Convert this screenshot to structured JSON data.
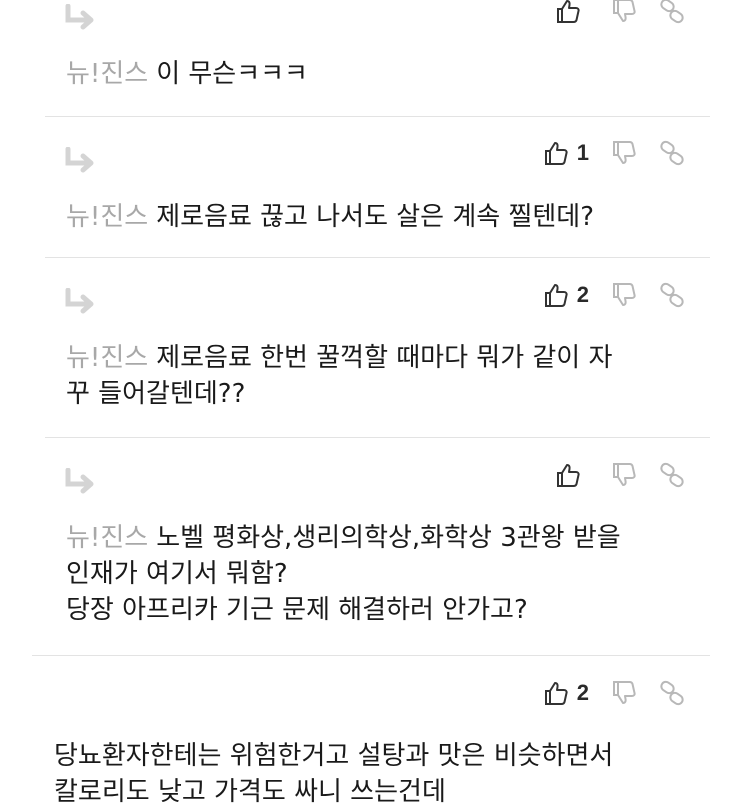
{
  "comments": [
    {
      "author": "뉴!진스",
      "lines": [
        "이 무슨ㅋㅋㅋ"
      ],
      "like_count": ""
    },
    {
      "author": "뉴!진스",
      "lines": [
        "제로음료 끊고 나서도 살은 계속 찔텐데?"
      ],
      "like_count": "1"
    },
    {
      "author": "뉴!진스",
      "lines": [
        "제로음료 한번 꿀꺽할 때마다 뭐가 같이 자",
        "꾸 들어갈텐데??"
      ],
      "like_count": "2"
    },
    {
      "author": "뉴!진스",
      "lines": [
        "노벨 평화상,생리의학상,화학상 3관왕 받을",
        "인재가 여기서 뭐함?",
        "당장 아프리카 기근 문제 해결하러 안가고?"
      ],
      "like_count": ""
    },
    {
      "author": "",
      "lines": [
        "당뇨환자한테는 위험한거고 설탕과 맛은 비슷하면서",
        "칼로리도 낮고 가격도 싸니 쓰는건데"
      ],
      "like_count": "2"
    }
  ],
  "icons": {
    "reply": "reply-arrow-icon",
    "like": "thumbs-up-icon",
    "dislike": "thumbs-down-icon",
    "link": "link-icon"
  }
}
